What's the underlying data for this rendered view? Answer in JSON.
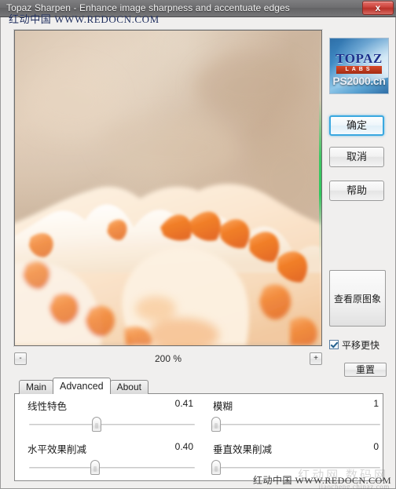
{
  "window": {
    "title": "Topaz Sharpen - Enhance image sharpness and accentuate edges",
    "close_label": "x"
  },
  "watermark": {
    "top": "红动中国 WWW.REDOCN.COM",
    "bottom": "红动中国 WWW.REDOCN.COM",
    "bottom_ghost": "红动网 数码网",
    "bottom_ghost2": "jiaocheng.chinaz.com"
  },
  "preview": {
    "alt": "blurred seashell preview",
    "zoom_minus": "-",
    "zoom_plus": "+",
    "zoom_value": "200 %"
  },
  "logo": {
    "topaz": "TOPAZ",
    "labs": "LABS",
    "ps2000": "PS2000.cn"
  },
  "buttons": {
    "ok": "确定",
    "cancel": "取消",
    "help": "帮助",
    "view_original": "查看原图象",
    "reset": "重置"
  },
  "checkbox": {
    "faster_pan_label": "平移更快",
    "faster_pan_checked": true
  },
  "tabs": [
    {
      "label": "Main",
      "active": false
    },
    {
      "label": "Advanced",
      "active": true
    },
    {
      "label": "About",
      "active": false
    }
  ],
  "sliders": [
    {
      "name": "linear-feature",
      "label": "线性特色",
      "value": "0.41",
      "percent": 41
    },
    {
      "name": "blur",
      "label": "模糊",
      "value": "1",
      "percent": 2
    },
    {
      "name": "horizontal-effect-reduction",
      "label": "水平效果削减",
      "value": "0.40",
      "percent": 40
    },
    {
      "name": "vertical-effect-reduction",
      "label": "垂直效果削减",
      "value": "0",
      "percent": 2
    }
  ],
  "colors": {
    "accent": "#3aa8e0",
    "close_red": "#b93129",
    "logo_blue": "#1c2f8a",
    "labs_red": "#d94a2a",
    "shell_orange": "#f07b22"
  }
}
